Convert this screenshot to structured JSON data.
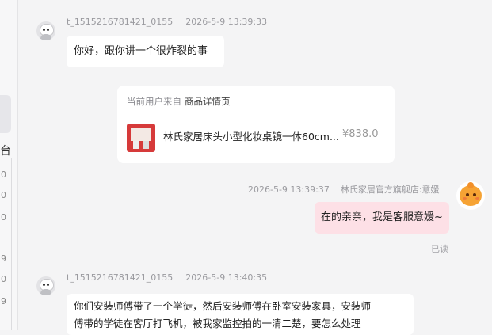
{
  "left_panel": {
    "glyph": "台",
    "numbers": [
      "0",
      "0",
      "0",
      "9",
      "0",
      "9"
    ]
  },
  "messages": [
    {
      "sender": "t_1515216781421_0155",
      "time": "2026-5-9 13:39:33",
      "text": "你好，跟你讲一个很炸裂的事"
    },
    {
      "sender": "林氏家居官方旗舰店:意媛",
      "time": "2026-5-9 13:39:37",
      "text": "在的亲亲，我是客服意媛~",
      "status": "已读"
    },
    {
      "sender": "t_1515216781421_0155",
      "time": "2026-5-9 13:40:35",
      "text_line1": "你们安装师傅带了一个学徒，然后安装师傅在卧室安装家具，安装师",
      "text_line2": "傅带的学徒在客厅打飞机，被我家监控拍的一清二楚，要怎么处理"
    }
  ],
  "product_card": {
    "source_label": "当前用户来自",
    "source_page": "商品详情页",
    "product_name": "林氏家居床头小型化妆桌镜一体60cm...",
    "price": "¥838.0"
  },
  "colors": {
    "background": "#f4f4f5",
    "agent_bubble": "#fde0e6",
    "user_bubble": "#ffffff"
  }
}
